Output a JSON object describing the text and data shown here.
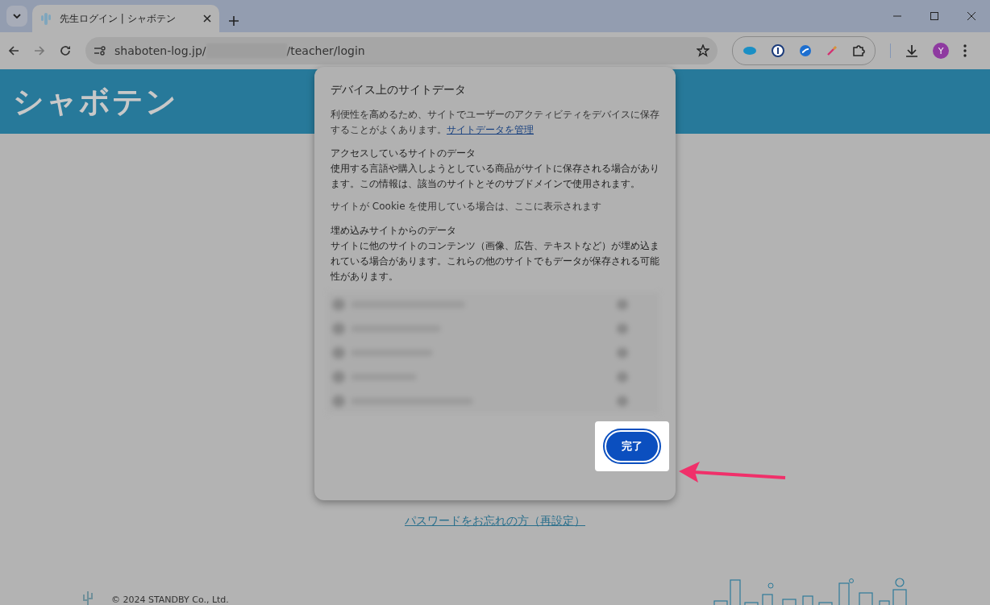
{
  "browser": {
    "tab": {
      "title": "先生ログイン | シャボテン",
      "selected": true
    },
    "address": {
      "host": "shaboten-log.jp/",
      "path": "/teacher/login"
    },
    "profile_initial": "Y"
  },
  "site": {
    "logo": "シャボテン",
    "forgot_password_link": "パスワードをお忘れの方（再設定）",
    "copyright": "© 2024 STANDBY Co., Ltd."
  },
  "dialog": {
    "title": "デバイス上のサイトデータ",
    "intro": "利便性を高めるため、サイトでユーザーのアクティビティをデバイスに保存することがよくあります。",
    "intro_link": "サイトデータを管理",
    "sections": [
      {
        "kind": "section",
        "heading": "アクセスしているサイトのデータ",
        "body": "使用する言語や購入しようとしている商品がサイトに保存される場合があります。この情報は、該当のサイトとそのサブドメインで使用されます。"
      },
      {
        "kind": "note",
        "body": "サイトが Cookie を使用している場合は、ここに表示されます"
      },
      {
        "kind": "section",
        "heading": "埋め込みサイトからのデータ",
        "body": "サイトに他のサイトのコンテンツ（画像、広告、テキストなど）が埋め込まれている場合があります。これらの他のサイトでもデータが保存される可能性があります。"
      }
    ],
    "done_button": "完了"
  }
}
